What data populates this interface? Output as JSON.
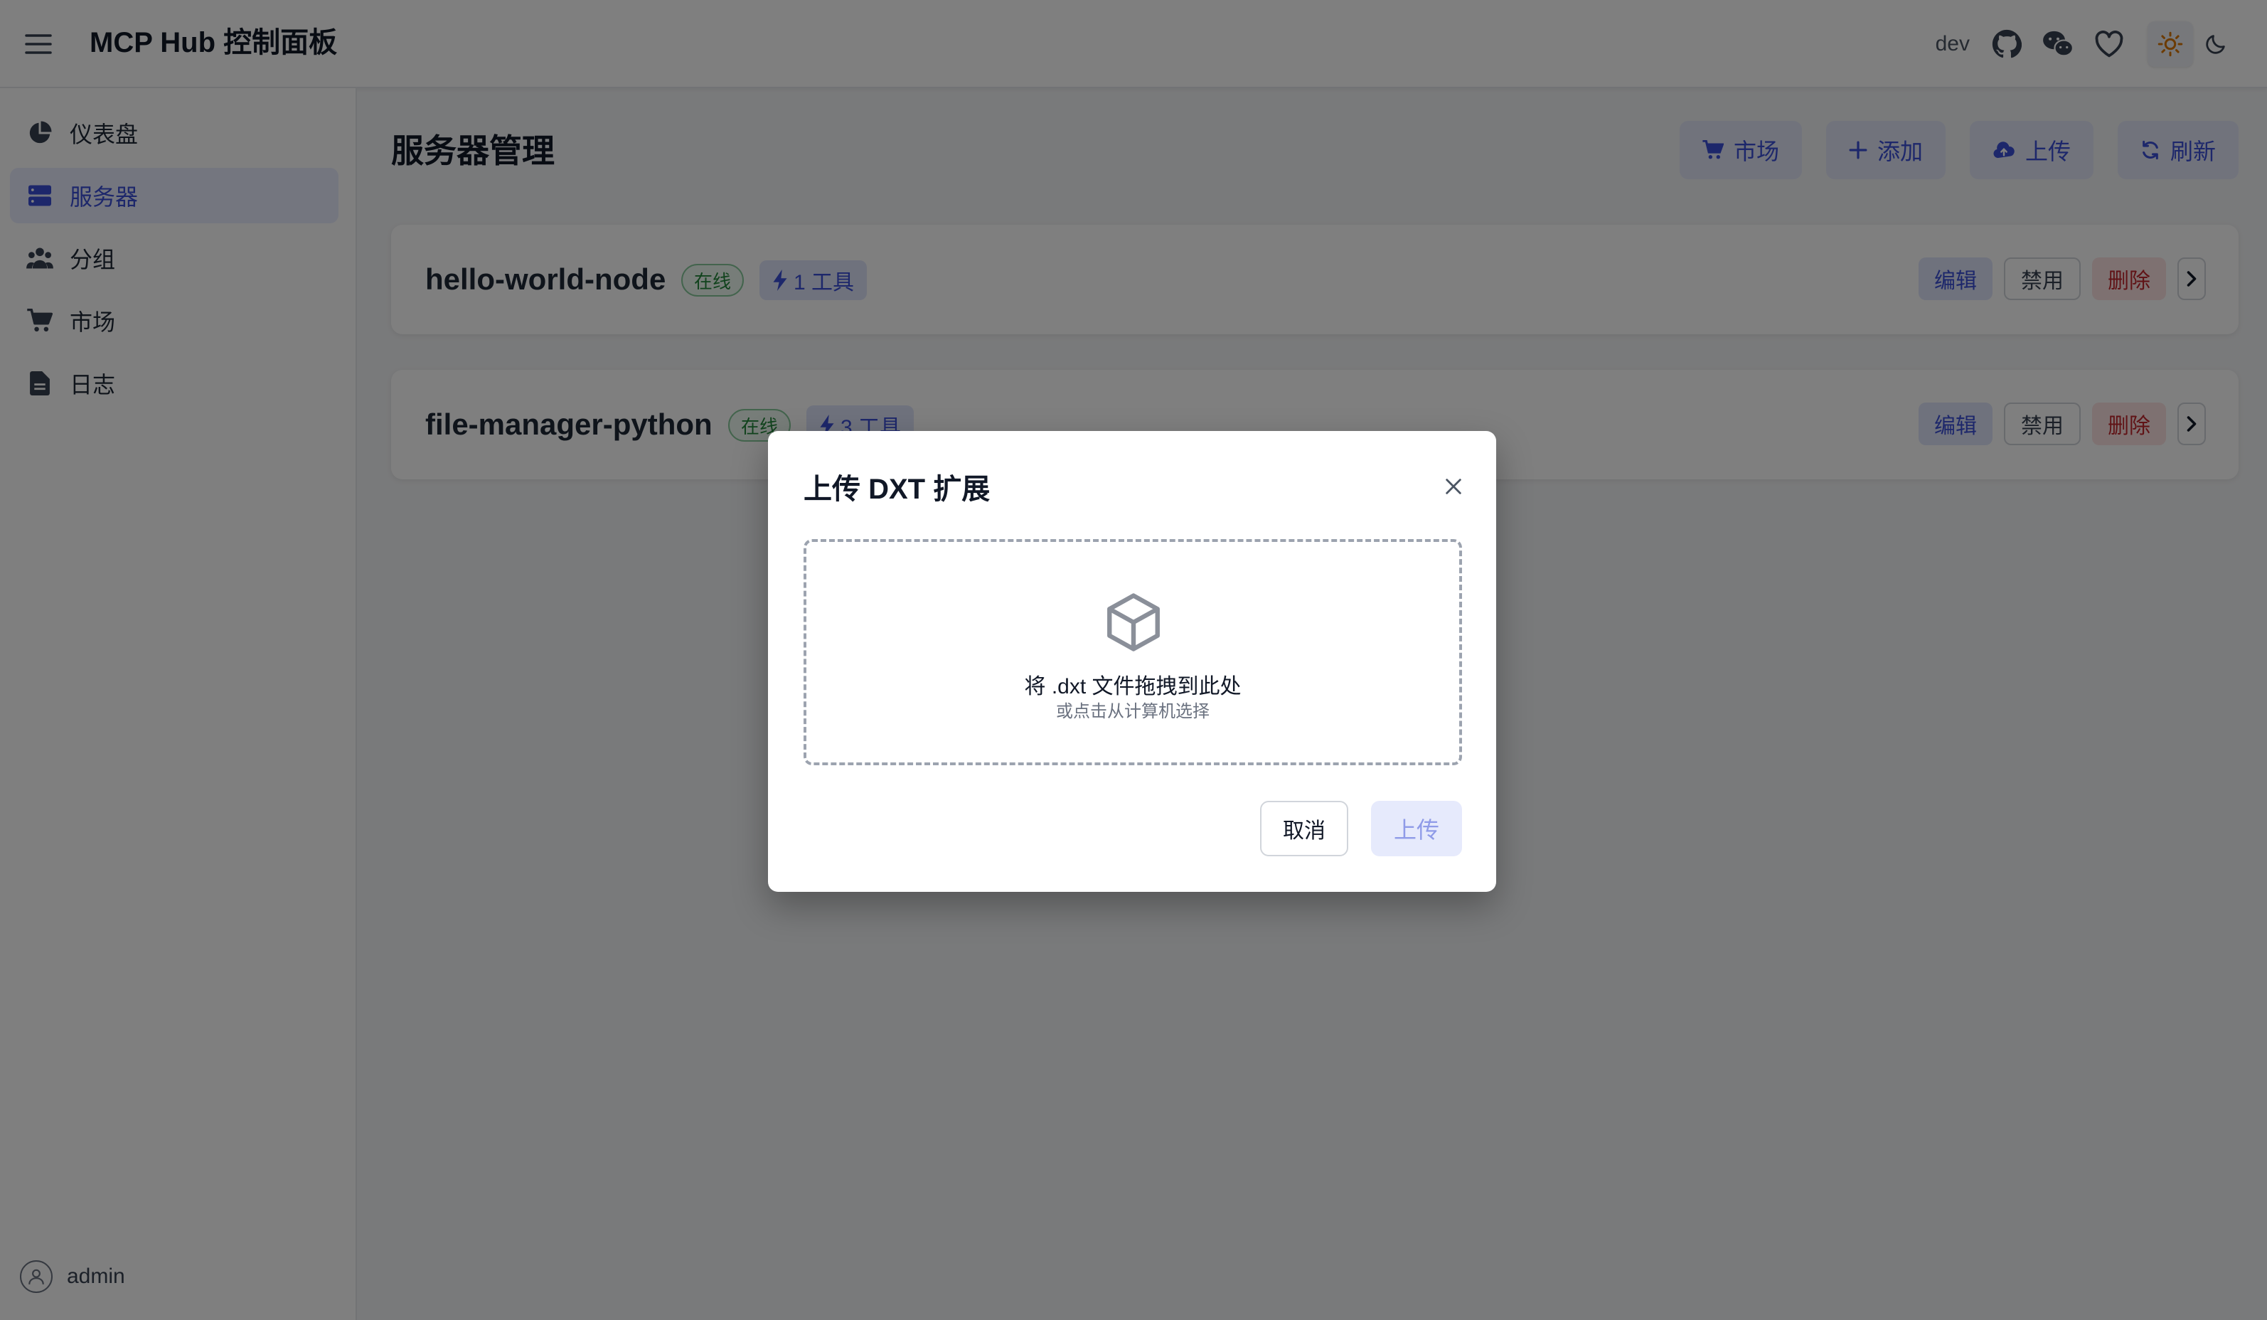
{
  "header": {
    "title": "MCP Hub 控制面板",
    "env_label": "dev",
    "icons": [
      "menu-icon",
      "github-icon",
      "wechat-icon",
      "heart-icon",
      "sun-icon",
      "moon-icon"
    ]
  },
  "sidebar": {
    "items": [
      {
        "label": "仪表盘",
        "icon": "pie-chart-icon",
        "active": false
      },
      {
        "label": "服务器",
        "icon": "server-icon",
        "active": true
      },
      {
        "label": "分组",
        "icon": "users-icon",
        "active": false
      },
      {
        "label": "市场",
        "icon": "cart-icon",
        "active": false
      },
      {
        "label": "日志",
        "icon": "document-icon",
        "active": false
      }
    ],
    "user": "admin"
  },
  "main": {
    "title": "服务器管理",
    "toolbar": {
      "market_label": "市场",
      "add_label": "添加",
      "upload_label": "上传",
      "refresh_label": "刷新"
    },
    "servers": [
      {
        "name": "hello-world-node",
        "status": "在线",
        "tools": "1 工具",
        "edit": "编辑",
        "disable": "禁用",
        "delete": "删除"
      },
      {
        "name": "file-manager-python",
        "status": "在线",
        "tools": "3 工具",
        "edit": "编辑",
        "disable": "禁用",
        "delete": "删除"
      }
    ]
  },
  "modal": {
    "title": "上传 DXT 扩展",
    "drop_main": "将 .dxt 文件拖拽到此处",
    "drop_sub": "或点击从计算机选择",
    "cancel_label": "取消",
    "upload_label": "上传"
  },
  "colors": {
    "accent": "#3b4fd6",
    "online": "#22863a",
    "danger": "#c0262d"
  }
}
